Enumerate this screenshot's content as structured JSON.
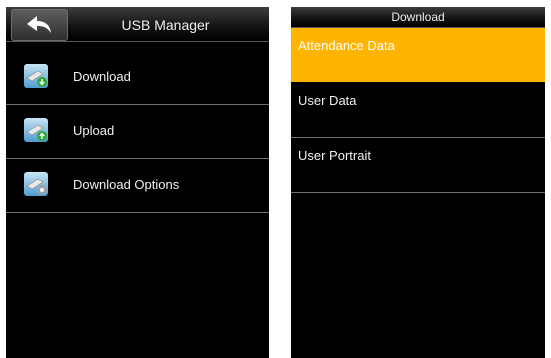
{
  "left_screen": {
    "title": "USB Manager",
    "items": [
      {
        "label": "Download",
        "icon": "usb-download-icon"
      },
      {
        "label": "Upload",
        "icon": "usb-upload-icon"
      },
      {
        "label": "Download Options",
        "icon": "usb-download-options-icon"
      }
    ]
  },
  "right_screen": {
    "title": "Download",
    "items": [
      {
        "label": "Attendance Data",
        "selected": true
      },
      {
        "label": "User Data",
        "selected": false
      },
      {
        "label": "User Portrait",
        "selected": false
      }
    ]
  },
  "colors": {
    "selected_background": "#ffb400",
    "screen_background": "#000000",
    "text": "#f0f0f0"
  }
}
